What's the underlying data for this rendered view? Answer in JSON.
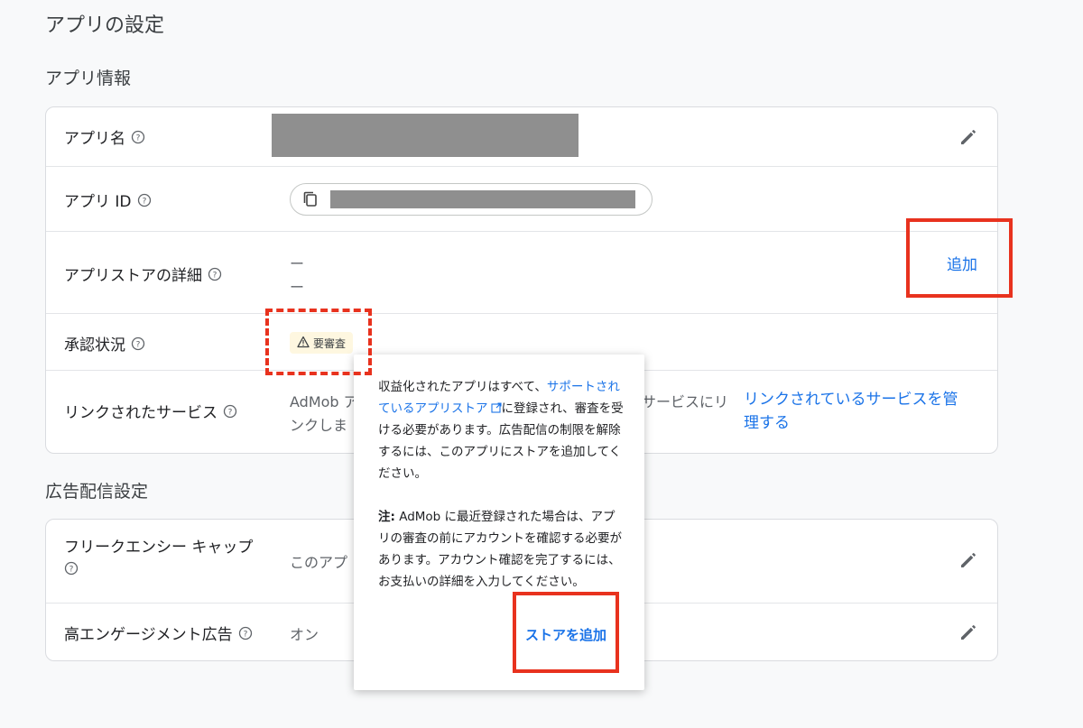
{
  "page": {
    "title": "アプリの設定"
  },
  "app_info": {
    "section_title": "アプリ情報",
    "rows": [
      {
        "label": "アプリ名"
      },
      {
        "label": "アプリ ID"
      },
      {
        "label": "アプリストアの詳細",
        "values": [
          "ー",
          "ー"
        ],
        "action": "追加"
      },
      {
        "label": "承認状況",
        "badge": "要審査"
      },
      {
        "label": "リンクされたサービス",
        "text_line1": "AdMob ア",
        "text_line2": "ンクしま",
        "text_right": "サービスにリ",
        "link_line1": "リンクされているサービスを管",
        "link_line2": "理する"
      }
    ]
  },
  "ad_serving": {
    "section_title": "広告配信設定",
    "rows": [
      {
        "label_line1": "フリークエンシー キャップ",
        "value": "このアプ"
      },
      {
        "label": "高エンゲージメント広告",
        "value": "オン"
      }
    ]
  },
  "popup": {
    "p1_before": "収益化されたアプリはすべて、",
    "p1_link": "サポートされているアプリストア",
    "p1_after": "に登録され、審査を受ける必要があります。広告配信の制限を解除するには、このアプリにストアを追加してください。",
    "p2_bold": "注:",
    "p2_text": " AdMob に最近登録された場合は、アプリの審査の前にアカウントを確認する必要があります。アカウント確認を完了するには、お支払いの詳細を入力してください。",
    "action": "ストアを追加"
  },
  "colors": {
    "accent": "#1a73e8",
    "highlight": "#e8321e",
    "badge_bg": "#fef7e0",
    "redaction": "#8f8f8f"
  }
}
